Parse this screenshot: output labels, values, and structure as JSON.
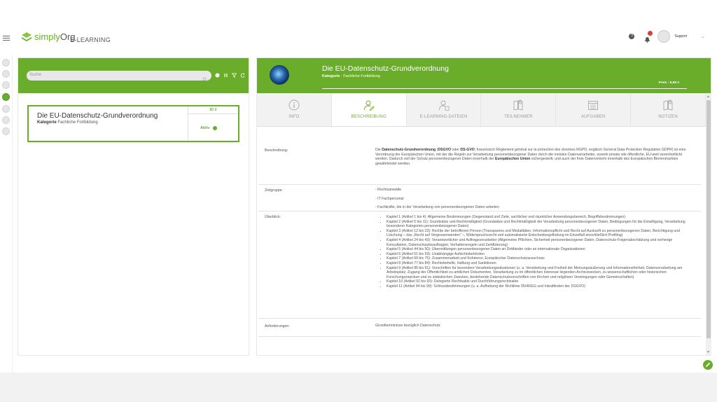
{
  "header": {
    "app_name_prefix": "simply",
    "app_name_suffix": "Org",
    "module_title": "E-LEARNING",
    "help_label": "?",
    "user_name": "Support",
    "caret": "⌄",
    "colors": {
      "accent": "#6aad2a",
      "badge": "#e43a3a"
    }
  },
  "left_panel": {
    "search_placeholder": "Suche",
    "course_card": {
      "title": "Die EU-Datenschutz-Grundverordnung",
      "category_label": "Kategorie",
      "category_value": "Fachliche Fortbildung",
      "id_label": "ID 2",
      "status": "Aktiv"
    }
  },
  "right_panel": {
    "title": "Die EU-Datenschutz-Grundverordnung",
    "category_label": "Kategorie",
    "category_value": "Fachliche Fortbildung",
    "price": "Preis : 9,99 €",
    "tabs": [
      {
        "label": "INFO",
        "icon": "info-icon"
      },
      {
        "label": "BESCHREIBUNG",
        "icon": "user-edit-icon"
      },
      {
        "label": "E-LEARNING-DATEIEN",
        "icon": "user-file-icon"
      },
      {
        "label": "TEILNEHMER",
        "icon": "book-icon"
      },
      {
        "label": "AUFGABEN",
        "icon": "calendar-icon"
      },
      {
        "label": "NOTIZEN",
        "icon": "notes-icon"
      }
    ],
    "active_tab": "BESCHREIBUNG",
    "beschreibung": {
      "label": "Beschreibung:",
      "text_1": "Die ",
      "bold_1": "Datenschutz-Grundverordnung",
      "text_2": " (",
      "bold_2": "DSGVO",
      "text_3": " oder ",
      "bold_3": "DS-GVO",
      "text_4": "; französisch Règlement général sur la protection des données RGPD, englisch General Data Protection Regulation GDPR) ist eine Verordnung der Europäischen Union, mit der die Regeln zur Verarbeitung personenbezogener Daten durch die meisten Datenverarbeiter, sowohl private wie öffentliche, EU-weit vereinheitlicht werden. Dadurch soll der Schutz personenbezogener Daten innerhalb der ",
      "bold_4": "Europäischen Union",
      "text_5": " sichergestellt, und auch der freie Datenverkehr innerhalb des Europäischen Binnenmarktes gewährleistet werden."
    },
    "zielgruppe": {
      "label": "Zielgruppe:",
      "items": [
        "- Rechtsanwälte",
        "- IT Fachpersonal",
        "- Fachkräfte, die in der Verarbeitung von personenbezogenen Daten arbeiten"
      ]
    },
    "ueberblick": {
      "label": "Überblick:",
      "items": [
        "Kapitel 1 (Artikel 1 bis 4): Allgemeine Bestimmungen (Gegenstand und Ziele, sachlicher und räumlicher Anwendungsbereich, Begriffsbestimmungen)",
        "Kapitel 2 (Artikel 5 bis 11): Grundsätze und Rechtmäßigkeit (Grundsätze und Rechtmäßigkeit der Verarbeitung personenbezogener Daten, Bedingungen für die Einwilligung, Verarbeitung besonderer Kategorien personenbezogener Daten)",
        "Kapitel 3 (Artikel 12 bis 23): Rechte der betroffenen Person (Transparenz und Modalitäten, Informationspflicht und Recht auf Auskunft zu personenbezogenen Daten, Berichtigung und Löschung – das „Recht auf Vergessenwerden“ –, Widerspruchsrecht und automatisierte Entscheidungsfindung im Einzelfall einschließlich Profiling)",
        "Kapitel 4 (Artikel 24 bis 43): Verantwortlicher und Auftragsverarbeiter (Allgemeine Pflichten, Sicherheit personenbezogener Daten, Datenschutz-Folgenabschätzung und vorherige Konsultation, Datenschutzbeauftragter, Verhaltensregeln und Zertifizierung)",
        "Kapitel 5 (Artikel 44 bis 50): Übermittlungen personenbezogener Daten an Drittländer oder an internationale Organisationen",
        "Kapitel 6 (Artikel 51 bis 59): Unabhängige Aufsichtsbehörden",
        "Kapitel 7 (Artikel 60 bis 76): Zusammenarbeit und Kohärenz, Europäischer Datenschutzausschuss",
        "Kapitel 8 (Artikel 77 bis 84): Rechtsbehelfe, Haftung und Sanktionen",
        "Kapitel 9 (Artikel 85 bis 91): Vorschriften für besondere Verarbeitungssituationen (u. a. Verarbeitung und Freiheit der Meinungsäußerung und Informationsfreiheit, Datenverarbeitung am Arbeitsplatz, Zugang der Öffentlichkeit zu amtlichen Dokumenten, Verarbeitung zu im öffentlichen Interesse liegenden Archivzwecken, zu wissenschaftlichen oder historischen Forschungszwecken und zu statistischen Zwecken, bestehende Datenschutzvorschriften von Kirchen und religiösen Vereinigungen oder Gemeinschaften)",
        "Kapitel 10 (Artikel 92 bis 93): Delegierte Rechtsakte und Durchführungsrechtsakte",
        "Kapitel 11 (Artikel 94 bis 99): Schlussbestimmungen (u. a. Aufhebung der Richtlinie 95/46/EG und Inkrafttreten der DSGVO)"
      ]
    },
    "anforderungen": {
      "label": "Anforderungen:",
      "value": "Grundkenntnisse bezüglich Datenschutz"
    }
  }
}
